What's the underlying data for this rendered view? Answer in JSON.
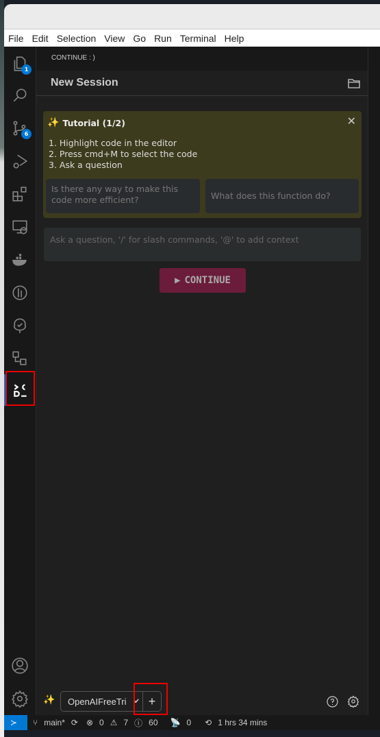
{
  "menu": [
    "File",
    "Edit",
    "Selection",
    "View",
    "Go",
    "Run",
    "Terminal",
    "Help"
  ],
  "activity": [
    {
      "icon": "explorer-icon",
      "badge": "1"
    },
    {
      "icon": "search-icon"
    },
    {
      "icon": "source-control-icon",
      "badge": "6"
    },
    {
      "icon": "run-debug-icon"
    },
    {
      "icon": "extensions-icon"
    },
    {
      "icon": "remote-explorer-icon"
    },
    {
      "icon": "docker-icon"
    },
    {
      "icon": "gitlens-icon"
    },
    {
      "icon": "testing-icon"
    },
    {
      "icon": "workflow-icon"
    },
    {
      "icon": "continue-icon"
    }
  ],
  "panel": {
    "header": "CONTINUE : )",
    "title": "New Session"
  },
  "tutorial": {
    "title": "Tutorial (1/2)",
    "steps": [
      "1. Highlight code in the editor",
      "2. Press cmd+M to select the code",
      "3. Ask a question"
    ],
    "suggestions": [
      "Is there any way to make this code more efficient?",
      "What does this function do?"
    ]
  },
  "input": {
    "placeholder": "Ask a question, '/' for slash commands, '@' to add context"
  },
  "continue_button": "CONTINUE",
  "footer": {
    "model": "OpenAIFreeTri",
    "add": "+"
  },
  "status": {
    "branch": "main*",
    "errors": "0",
    "warnings": "7",
    "info": "60",
    "ports": "0",
    "time": "1 hrs 34 mins"
  },
  "colors": {
    "accent": "#0078d4",
    "tutorial_bg": "#3d3b1d",
    "continue_bg": "#6b1c3a",
    "highlight": "#e00000"
  }
}
